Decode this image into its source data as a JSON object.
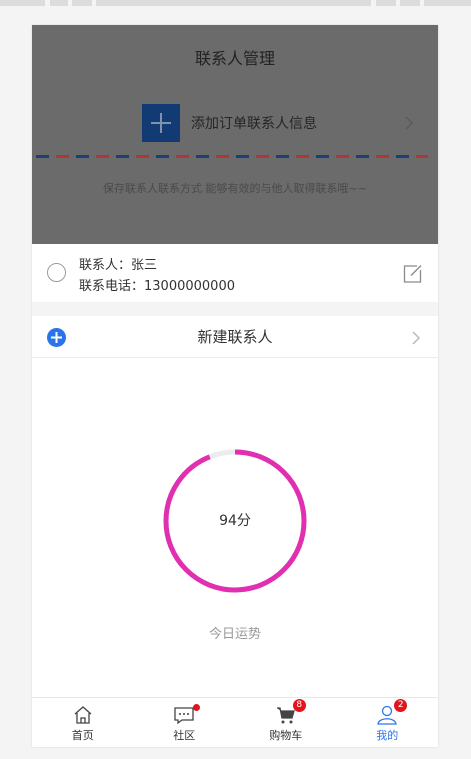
{
  "header": {
    "title": "联系人管理",
    "add_label": "添加订单联系人信息",
    "note": "保存联系人联系方式 能够有效的与他人取得联系哦~~"
  },
  "contact": {
    "name_line": "联系人：张三",
    "phone_line": "联系电话：13000000000"
  },
  "new_contact": {
    "label": "新建联系人"
  },
  "fortune": {
    "score": 94,
    "score_label": "94分",
    "caption": "今日运势"
  },
  "tabbar": {
    "items": [
      {
        "label": "首页",
        "icon": "home-icon",
        "active": false
      },
      {
        "label": "社区",
        "icon": "chat-icon",
        "active": false,
        "dot": true
      },
      {
        "label": "购物车",
        "icon": "cart-icon",
        "active": false,
        "badge": "8"
      },
      {
        "label": "我的",
        "icon": "user-icon",
        "active": true,
        "badge": "2"
      }
    ]
  },
  "colors": {
    "accent": "#2a74ea",
    "gauge": "#e02fb0",
    "badge": "#e5131b",
    "header_overlay": "#6b6b6b"
  }
}
